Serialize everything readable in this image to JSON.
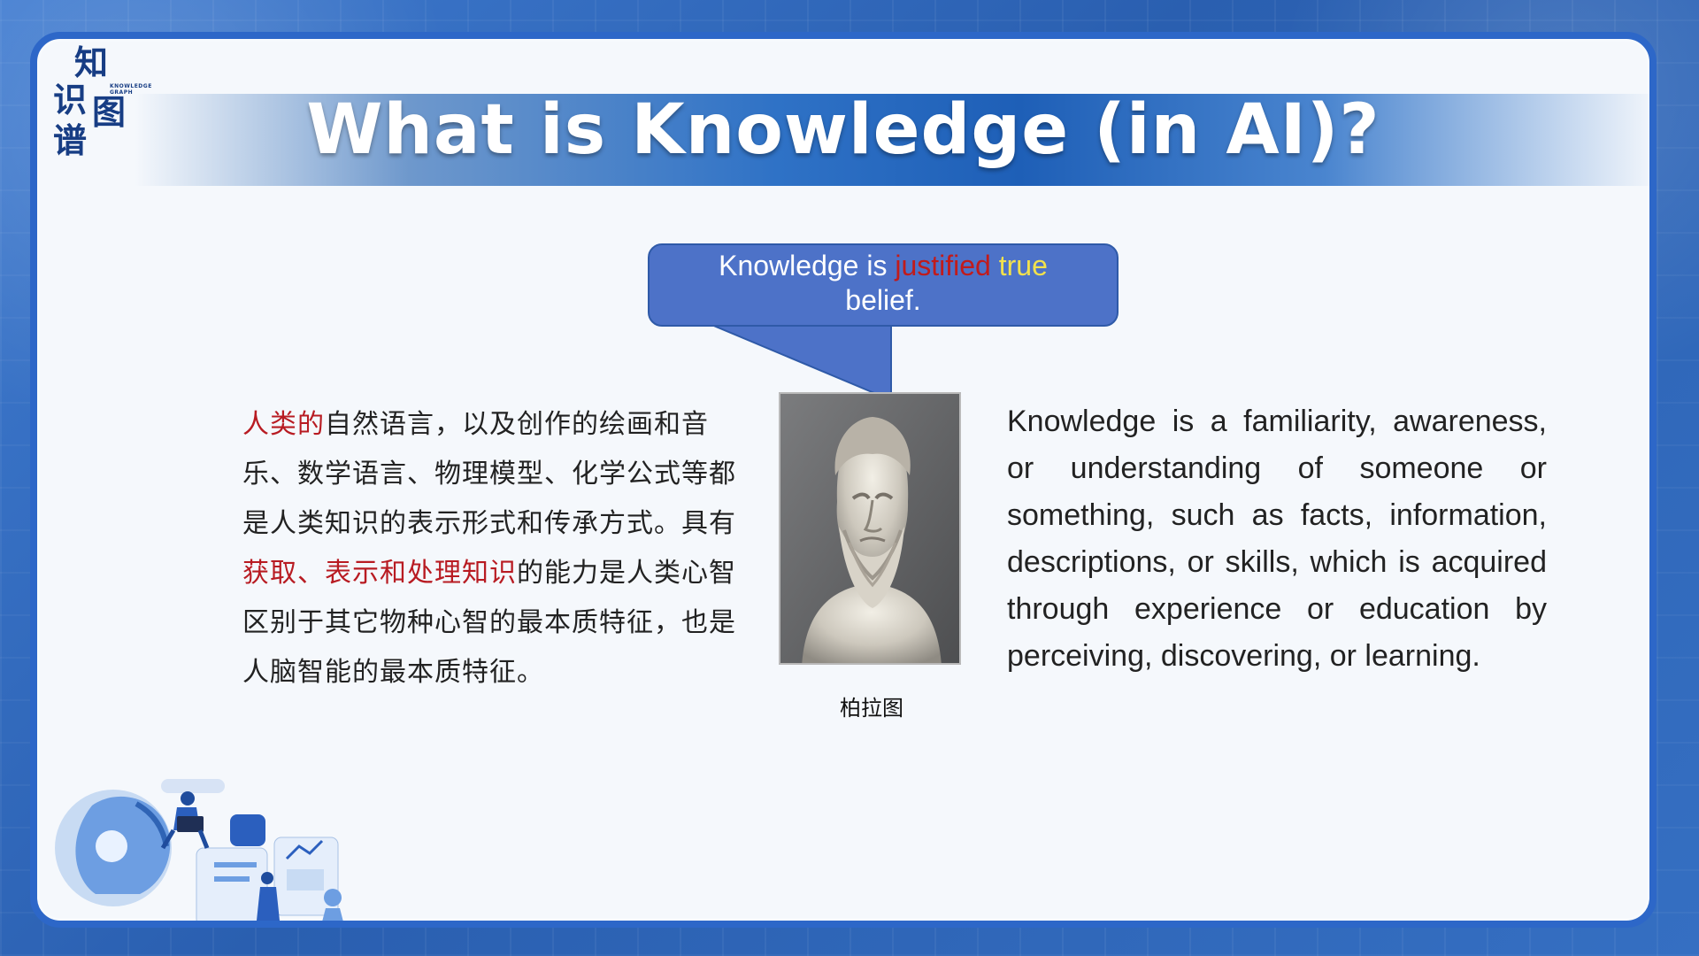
{
  "logo": {
    "chars": [
      "知",
      "识",
      "图",
      "谱"
    ],
    "subtitle": "KNOWLEDGE GRAPH"
  },
  "title": "What is Knowledge (in AI)?",
  "bubble": {
    "prefix": "Knowledge is ",
    "justified": "justified",
    "true_word": "true",
    "suffix": "belief."
  },
  "chinese_text": {
    "part1": "人类的",
    "part2": "自然语言，以及创作的绘画和音乐、数学语言、物理模型、化学公式等都是人类知识的表示形式和传承方式。具有",
    "part3": "获取、表示和处理知识",
    "part4": "的能力是人类心智区别于其它物种心智的最本质特征，也是人脑智能的最本质特征。"
  },
  "portrait_caption": "柏拉图",
  "english_text": "Knowledge is a familiarity, awareness, or understanding of someone or something, such as facts, information, descriptions, or skills, which is acquired through experience or education by perceiving, discovering, or learning.",
  "colors": {
    "frame_blue": "#2d67c8",
    "bubble_blue": "#4d72c8",
    "highlight_red": "#b81b22",
    "highlight_yellow": "#f2e14c"
  },
  "icons": [
    "logo-mark",
    "plato-bust-image",
    "ai-work-illustration"
  ]
}
